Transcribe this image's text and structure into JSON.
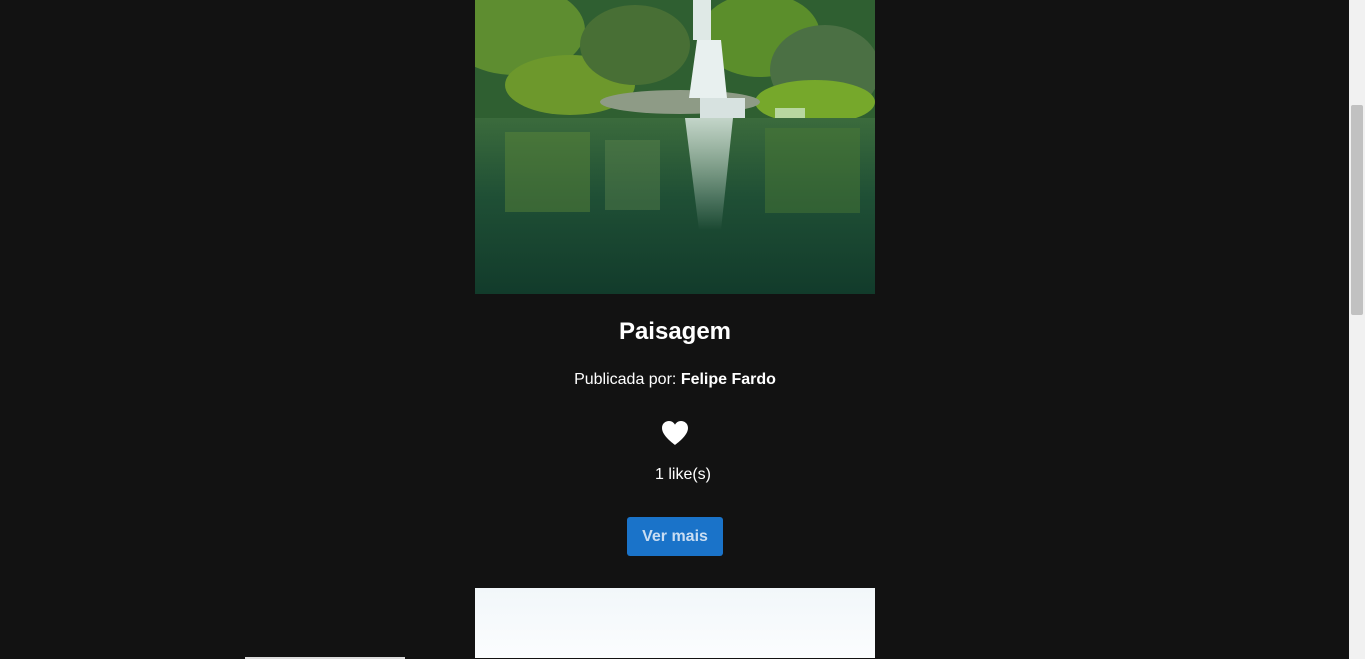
{
  "post": {
    "image_subject": "waterfall-landscape",
    "title": "Paisagem",
    "author_prefix": "Publicada por:",
    "author_name": "Felipe Fardo",
    "like_icon": "heart-icon",
    "likes_text": "1 like(s)",
    "more_button_label": "Ver mais"
  },
  "next_post": {
    "image_subject": "bright-sky"
  },
  "colors": {
    "background": "#121212",
    "button": "#1a73c9",
    "text": "#ffffff"
  }
}
